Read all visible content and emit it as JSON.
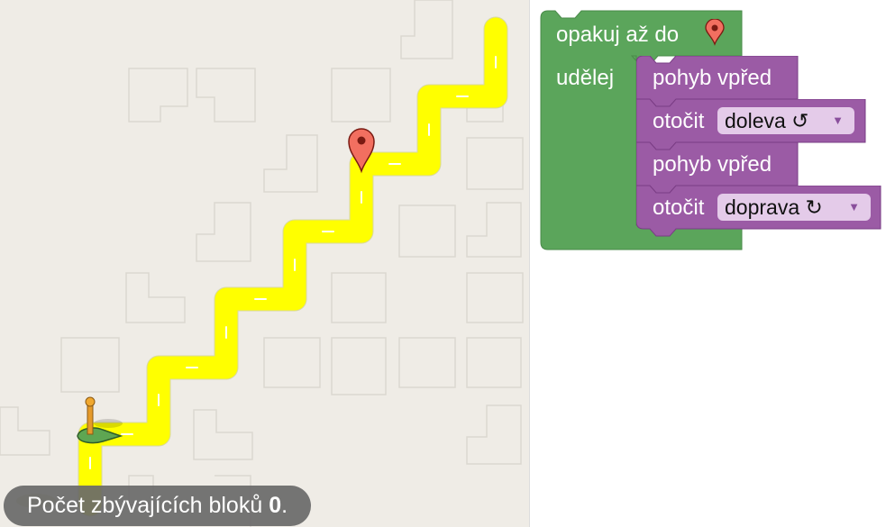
{
  "maze": {
    "status_prefix": "Počet zbývajících bloků",
    "remaining_blocks": "0",
    "status_suffix": ".",
    "path_color": "#ffff00",
    "background_color": "#efece6"
  },
  "blocks": {
    "loop": {
      "label": "opakuj až do",
      "do_label": "udělej",
      "color": "#5ba55b"
    },
    "statements": [
      {
        "type": "move",
        "label": "pohyb vpřed"
      },
      {
        "type": "turn",
        "label": "otočit",
        "dropdown": "doleva ↺"
      },
      {
        "type": "move",
        "label": "pohyb vpřed"
      },
      {
        "type": "turn",
        "label": "otočit",
        "dropdown": "doprava ↻"
      }
    ],
    "statement_color": "#9b5ba5"
  },
  "icons": [
    "goal-marker-icon",
    "pegman-icon",
    "dropdown-arrow-icon"
  ]
}
